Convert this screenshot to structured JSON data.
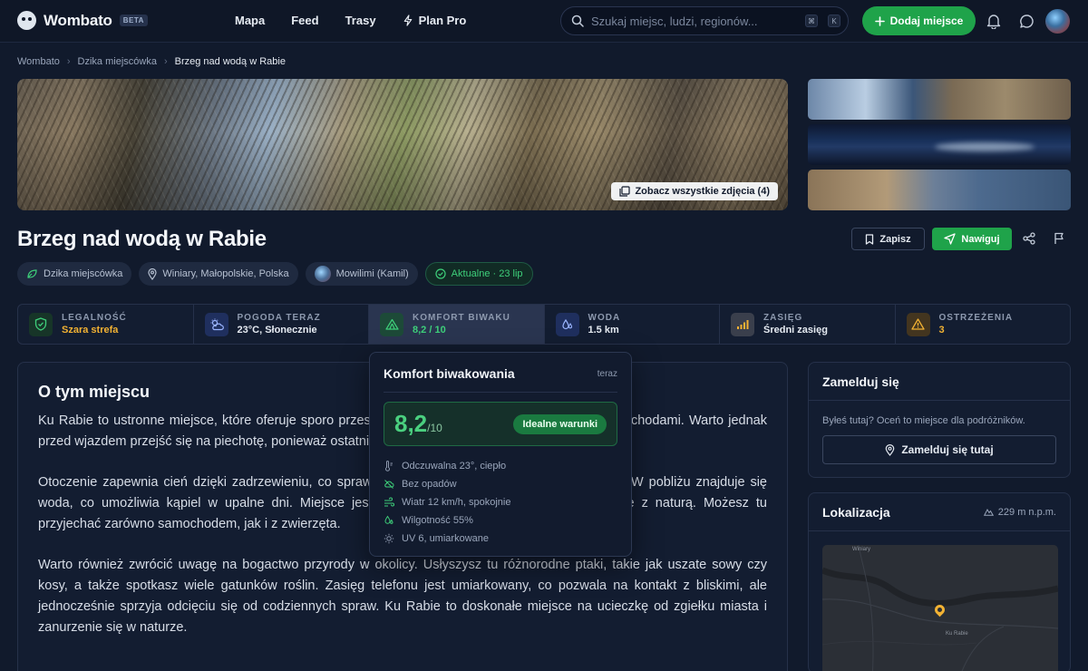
{
  "brand": {
    "name": "Wombato",
    "badge": "BETA"
  },
  "nav": {
    "links": [
      {
        "label": "Mapa"
      },
      {
        "label": "Feed"
      },
      {
        "label": "Trasy"
      },
      {
        "label": "Plan Pro"
      }
    ],
    "search_placeholder": "Szukaj miejsc, ludzi, regionów...",
    "search_keys": [
      "⌘",
      "K"
    ],
    "add_label": "Dodaj miejsce"
  },
  "breadcrumb": [
    "Wombato",
    "Dzika miejscówka",
    "Brzeg nad wodą w Rabie"
  ],
  "photos": {
    "see_all": "Zobacz wszystkie zdjęcia (4)"
  },
  "place": {
    "title": "Brzeg nad wodą w Rabie",
    "save_label": "Zapisz",
    "navigate_label": "Nawiguj",
    "chips": {
      "category": "Dzika miejscówka",
      "location": "Winiary, Małopolskie, Polska",
      "author": "Mowilimi (Kamil)",
      "status": "Aktualne · 23 lip"
    }
  },
  "stats": [
    {
      "label": "LEGALNOŚĆ",
      "value": "Szara strefa",
      "color": "#f2b233"
    },
    {
      "label": "POGODA TERAZ",
      "value": "23°C, Słonecznie",
      "color": "#e6ebf2"
    },
    {
      "label": "KOMFORT BIWAKU",
      "value": "8,2 / 10",
      "color": "#3ecf7a"
    },
    {
      "label": "WODA",
      "value": "1.5 km",
      "color": "#e6ebf2"
    },
    {
      "label": "ZASIĘG",
      "value": "Średni zasięg",
      "color": "#e6ebf2"
    },
    {
      "label": "OSTRZEŻENIA",
      "value": "3",
      "color": "#f2b233"
    }
  ],
  "about": {
    "title": "O tym miejscu",
    "paragraphs": [
      "Ku Rabie to ustronne miejsce, które oferuje sporo przestrzeni. Jest idealne dla podróżników z samochodami. Warto jednak przed wjazdem przejść się na piechotę, ponieważ ostatni odcinek jest nieutwardzony.",
      "Otoczenie zapewnia cień dzięki zadrzewieniu, co sprawia, że można tu miło spędzić popołudniek. W pobliżu znajduje się woda, co umożliwia kąpiel w upalne dni. Miejsce jest sprzyjające relaksowi w bliskim kontakcie z naturą. Możesz tu przyjechać zarówno samochodem, jak i z zwierzęta.",
      "Warto również zwrócić uwagę na bogactwo przyrody w okolicy. Usłyszysz tu różnorodne ptaki, takie jak uszate sowy czy kosy, a także spotkasz wiele gatunków roślin. Zasięg telefonu jest umiarkowany, co pozwala na kontakt z bliskimi, ale jednocześnie sprzyja odcięciu się od codziennych spraw. Ku Rabie to doskonałe miejsce na ucieczkę od zgiełku miasta i zanurzenie się w naturze."
    ]
  },
  "comfort": {
    "title": "Komfort biwakowania",
    "time": "teraz",
    "score": "8,2",
    "score_max": "/10",
    "badge": "Idealne warunki",
    "conditions": [
      {
        "icon": "thermometer-icon",
        "text": "Odczuwalna 23°, ciepło"
      },
      {
        "icon": "no-rain-icon",
        "text": "Bez opadów"
      },
      {
        "icon": "wind-icon",
        "text": "Wiatr 12 km/h, spokojnie"
      },
      {
        "icon": "humidity-icon",
        "text": "Wilgotność 55%"
      },
      {
        "icon": "sun-icon",
        "text": "UV 6, umiarkowane"
      }
    ]
  },
  "checkin": {
    "title": "Zamelduj się",
    "question": "Byłeś tutaj? Oceń to miejsce dla podróżników.",
    "button": "Zamelduj się tutaj"
  },
  "location": {
    "title": "Lokalizacja",
    "elevation": "229 m n.p.m.",
    "map_labels": [
      "Winiary",
      "Ku Rabie"
    ]
  }
}
